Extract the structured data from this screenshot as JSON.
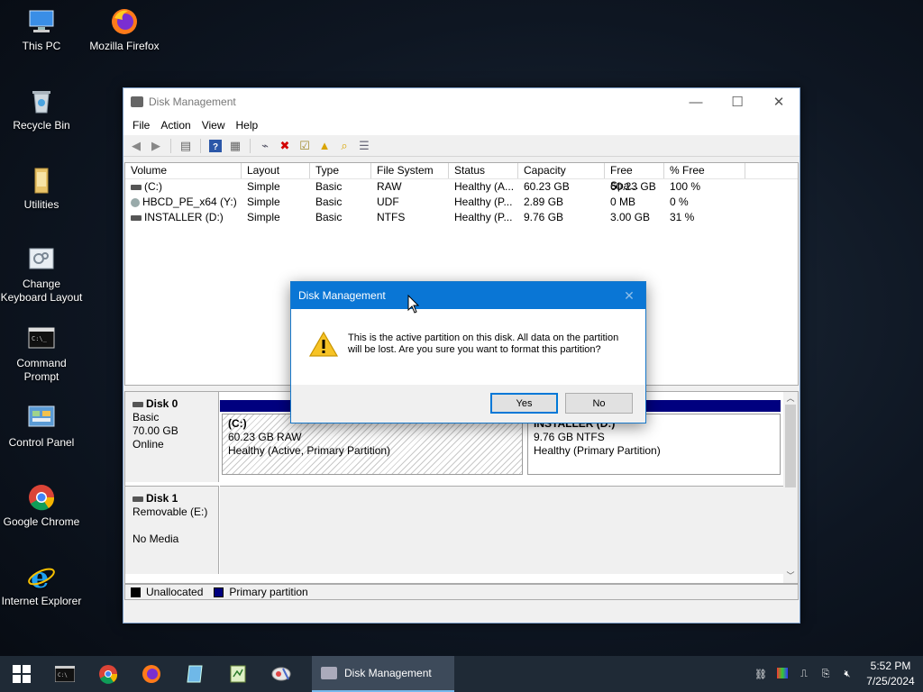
{
  "desktop": {
    "icons": [
      {
        "label": "This PC",
        "icon": "computer-icon"
      },
      {
        "label": "Mozilla Firefox",
        "icon": "firefox-icon"
      },
      {
        "label": "Recycle Bin",
        "icon": "recycle-bin-icon"
      },
      {
        "label": "Utilities",
        "icon": "folder-icon"
      },
      {
        "label": "Change Keyboard Layout",
        "icon": "keyboard-icon"
      },
      {
        "label": "Command Prompt",
        "icon": "cmd-icon"
      },
      {
        "label": "Control Panel",
        "icon": "control-panel-icon"
      },
      {
        "label": "Google Chrome",
        "icon": "chrome-icon"
      },
      {
        "label": "Internet Explorer",
        "icon": "ie-icon"
      }
    ]
  },
  "window": {
    "title": "Disk Management",
    "menu": [
      "File",
      "Action",
      "View",
      "Help"
    ],
    "columns": [
      "Volume",
      "Layout",
      "Type",
      "File System",
      "Status",
      "Capacity",
      "Free Spa...",
      "% Free"
    ],
    "volumes": [
      {
        "volume": "(C:)",
        "layout": "Simple",
        "type": "Basic",
        "fs": "RAW",
        "status": "Healthy (A...",
        "capacity": "60.23 GB",
        "free": "60.23 GB",
        "pct": "100 %"
      },
      {
        "volume": "HBCD_PE_x64 (Y:)",
        "layout": "Simple",
        "type": "Basic",
        "fs": "UDF",
        "status": "Healthy (P...",
        "capacity": "2.89 GB",
        "free": "0 MB",
        "pct": "0 %"
      },
      {
        "volume": "INSTALLER (D:)",
        "layout": "Simple",
        "type": "Basic",
        "fs": "NTFS",
        "status": "Healthy (P...",
        "capacity": "9.76 GB",
        "free": "3.00 GB",
        "pct": "31 %"
      }
    ],
    "disks": [
      {
        "name": "Disk 0",
        "type": "Basic",
        "size": "70.00 GB",
        "state": "Online",
        "partitions": [
          {
            "name": "(C:)",
            "size": "60.23 GB RAW",
            "status": "Healthy (Active, Primary Partition)"
          },
          {
            "name": "INSTALLER (D:)",
            "size": "9.76 GB NTFS",
            "status": "Healthy (Primary Partition)"
          }
        ]
      },
      {
        "name": "Disk 1",
        "type": "Removable (E:)",
        "state": "No Media"
      }
    ],
    "legend": [
      {
        "label": "Unallocated",
        "color": "#000000"
      },
      {
        "label": "Primary partition",
        "color": "#00007f"
      }
    ]
  },
  "dialog": {
    "title": "Disk Management",
    "message": "This is the active partition on this disk. All data on the partition will be lost. Are you sure you want to format this partition?",
    "yes": "Yes",
    "no": "No"
  },
  "taskbar": {
    "active_app": "Disk Management",
    "time": "5:52 PM",
    "date": "7/25/2024"
  }
}
